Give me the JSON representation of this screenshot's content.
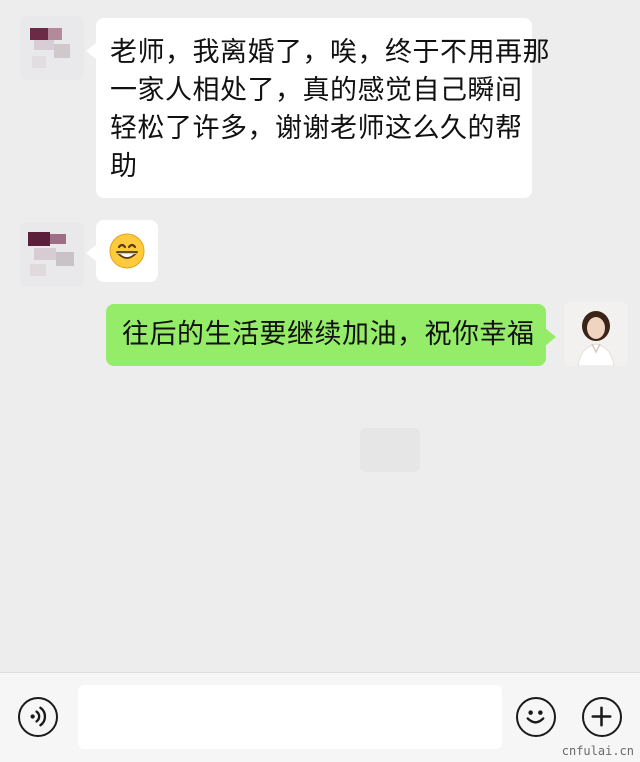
{
  "chat": {
    "messages": [
      {
        "sender": "other",
        "lines": [
          "老师，我离婚了，唉，终于不用再那",
          "一家人相处了，真的感觉自己瞬间",
          "轻松了许多，谢谢老师这么久的帮",
          "助"
        ]
      },
      {
        "sender": "other",
        "emoji": "😄"
      },
      {
        "sender": "self",
        "text": "往后的生活要继续加油，祝你幸福"
      }
    ]
  },
  "input_bar": {
    "voice_icon": "voice-icon",
    "emoji_icon": "emoji-icon",
    "plus_icon": "plus-icon",
    "input_value": ""
  },
  "watermark": "cnfulai.cn",
  "colors": {
    "background": "#ededed",
    "self_bubble": "#95ec69",
    "other_bubble": "#ffffff"
  }
}
